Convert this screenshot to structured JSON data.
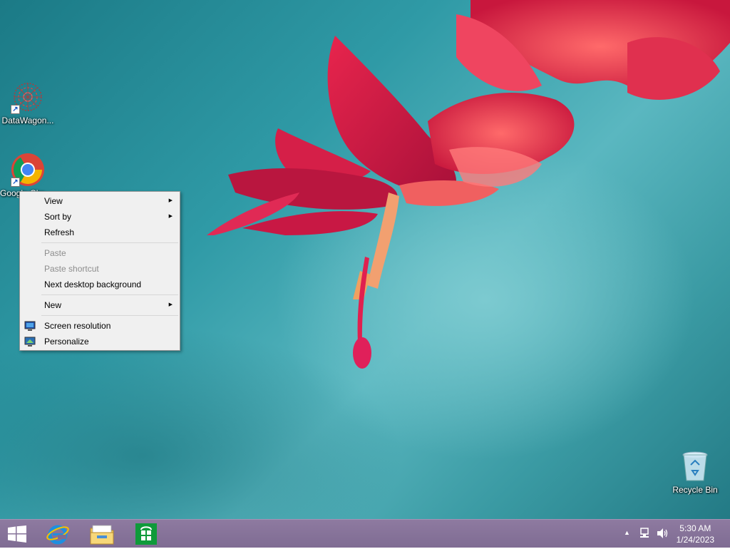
{
  "desktop_icons": [
    {
      "name": "DataWagon...",
      "icon": "datawagon-icon"
    },
    {
      "name": "Google Chrome",
      "label_visible": "G\nC",
      "icon": "chrome-icon"
    },
    {
      "name": "Recycle Bin",
      "icon": "recycle-bin-icon"
    }
  ],
  "context_menu": {
    "items": [
      {
        "label": "View",
        "submenu": true,
        "enabled": true
      },
      {
        "label": "Sort by",
        "submenu": true,
        "enabled": true
      },
      {
        "label": "Refresh",
        "enabled": true
      },
      {
        "label": "Paste",
        "enabled": false
      },
      {
        "label": "Paste shortcut",
        "enabled": false
      },
      {
        "label": "Next desktop background",
        "enabled": true
      },
      {
        "label": "New",
        "submenu": true,
        "enabled": true
      },
      {
        "label": "Screen resolution",
        "icon": "screen-resolution-icon",
        "enabled": true
      },
      {
        "label": "Personalize",
        "icon": "personalize-icon",
        "enabled": true
      }
    ]
  },
  "taskbar": {
    "pinned": [
      "start-icon",
      "internet-explorer-icon",
      "file-explorer-icon",
      "store-icon"
    ],
    "tray": {
      "time": "5:30 AM",
      "date": "1/24/2023",
      "icons": [
        "show-hidden-icons-arrow",
        "network-icon",
        "volume-icon"
      ]
    }
  },
  "colors": {
    "taskbar": "#7f6c93",
    "desktop_background": "#2f9aa6",
    "flower": "#d8244a"
  }
}
